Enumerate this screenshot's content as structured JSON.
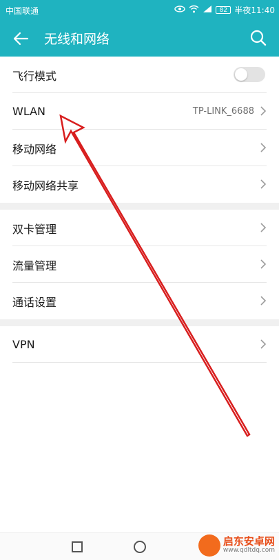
{
  "status_bar": {
    "carrier": "中国联通",
    "battery": "82",
    "time": "半夜11:40",
    "icons": [
      "eye-comfort-icon",
      "wifi-icon",
      "4g-signal-icon",
      "battery-icon"
    ]
  },
  "header": {
    "title": "无线和网络",
    "back_icon": "back-arrow-icon",
    "search_icon": "search-icon",
    "background": "#1fb3c0"
  },
  "groups": [
    {
      "items": [
        {
          "label": "飞行模式",
          "control": "toggle",
          "toggle_on": false
        },
        {
          "label": "WLAN",
          "value": "TP-LINK_6688",
          "control": "chevron"
        },
        {
          "label": "移动网络",
          "control": "chevron"
        },
        {
          "label": "移动网络共享",
          "control": "chevron"
        }
      ]
    },
    {
      "items": [
        {
          "label": "双卡管理",
          "control": "chevron"
        },
        {
          "label": "流量管理",
          "control": "chevron"
        },
        {
          "label": "通话设置",
          "control": "chevron"
        }
      ]
    },
    {
      "items": [
        {
          "label": "VPN",
          "control": "chevron"
        }
      ]
    }
  ],
  "nav_bar": {
    "icons": [
      "recent-apps-icon",
      "home-icon"
    ]
  },
  "watermark": {
    "title": "启东安卓网",
    "url": "www.qdltdq.com"
  },
  "annotation": {
    "type": "red-arrow",
    "color": "#d81e1e"
  }
}
